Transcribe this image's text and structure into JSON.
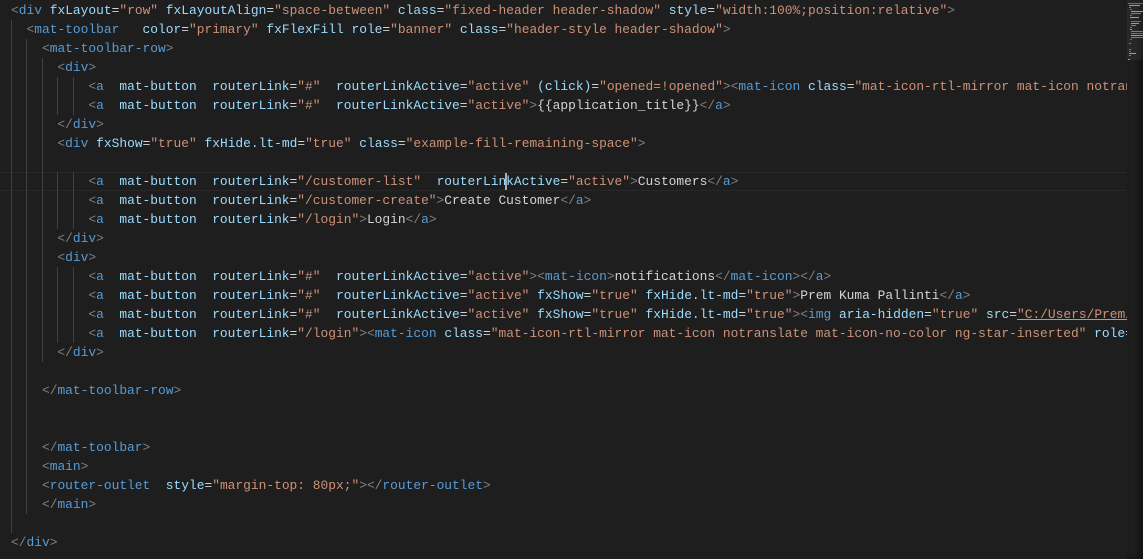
{
  "editor": {
    "cursor": {
      "line": 9,
      "column": 64
    },
    "current_line": 9,
    "link_text": "\"C:/Users/Prem/",
    "lines": [
      "<div fxLayout=\"row\" fxLayoutAlign=\"space-between\" class=\"fixed-header header-shadow\" style=\"width:100%;position:relative\">",
      "  <mat-toolbar   color=\"primary\" fxFlexFill role=\"banner\" class=\"header-style header-shadow\">",
      "    <mat-toolbar-row>",
      "      <div>",
      "          <a  mat-button  routerLink=\"#\"  routerLinkActive=\"active\" (click)=\"opened=!opened\"><mat-icon class=\"mat-icon-rtl-mirror mat-icon notran",
      "          <a  mat-button  routerLink=\"#\"  routerLinkActive=\"active\">{{application_title}}</a>",
      "      </div>",
      "      <div fxShow=\"true\" fxHide.lt-md=\"true\" class=\"example-fill-remaining-space\">",
      "",
      "          <a  mat-button  routerLink=\"/customer-list\"  routerLinkActive=\"active\">Customers</a>",
      "          <a  mat-button  routerLink=\"/customer-create\">Create Customer</a>",
      "          <a  mat-button  routerLink=\"/login\">Login</a>",
      "      </div>",
      "      <div>",
      "          <a  mat-button  routerLink=\"#\"  routerLinkActive=\"active\"><mat-icon>notifications</mat-icon></a>",
      "          <a  mat-button  routerLink=\"#\"  routerLinkActive=\"active\" fxShow=\"true\" fxHide.lt-md=\"true\">Prem Kuma Pallinti</a>",
      "          <a  mat-button  routerLink=\"#\"  routerLinkActive=\"active\" fxShow=\"true\" fxHide.lt-md=\"true\"><img aria-hidden=\"true\" src=\"C:/Users/Prem/",
      "          <a  mat-button  routerLink=\"/login\"><mat-icon class=\"mat-icon-rtl-mirror mat-icon notranslate mat-icon-no-color ng-star-inserted\" role=",
      "      </div>",
      "",
      "    </mat-toolbar-row>",
      "",
      "",
      "    </mat-toolbar>",
      "    <main>",
      "    <router-outlet  style=\"margin-top: 80px;\"></router-outlet>",
      "    </main>",
      "",
      "</div>"
    ]
  },
  "colors": {
    "background": "#1e1e1e",
    "punctuation": "#808080",
    "tag": "#569cd6",
    "attribute": "#9cdcfe",
    "string": "#ce9178",
    "text": "#d4d4d4"
  }
}
